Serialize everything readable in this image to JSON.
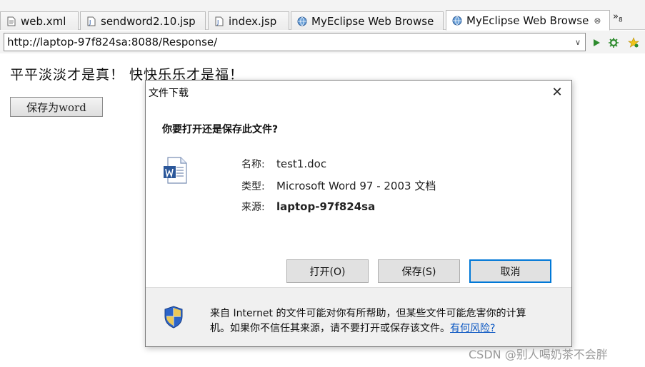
{
  "tabs": [
    {
      "label": "web.xml",
      "icon": "xml-file-icon",
      "active": false
    },
    {
      "label": "sendword2.10.jsp",
      "icon": "jsp-file-icon",
      "active": false
    },
    {
      "label": "index.jsp",
      "icon": "jsp-file-icon",
      "active": false
    },
    {
      "label": "MyEclipse Web Browse",
      "icon": "globe-icon",
      "active": false
    },
    {
      "label": "MyEclipse Web Browse",
      "icon": "globe-icon",
      "active": true,
      "close": "⊗"
    }
  ],
  "tab_overflow": {
    "label": "»",
    "count": "8"
  },
  "urlbar": {
    "url": "http://laptop-97f824sa:8088/Response/",
    "dropdown": "∨",
    "go_icon": "play-icon",
    "settings_icon": "gear-icon",
    "bookmark_icon": "star-icon",
    "accent": "#2e8b2e"
  },
  "page": {
    "text": "平平淡淡才是真！ 快快乐乐才是福！",
    "button_label": "保存为word"
  },
  "dialog": {
    "title": "文件下载",
    "close": "✕",
    "question": "你要打开还是保存此文件?",
    "name_label": "名称:",
    "name_value": "test1.doc",
    "type_label": "类型:",
    "type_value": "Microsoft Word 97 - 2003 文档",
    "source_label": "来源:",
    "source_value": "laptop-97f824sa",
    "open_button": "打开(O)",
    "save_button": "保存(S)",
    "cancel_button": "取消",
    "note_line1": "来自 Internet 的文件可能对你有所帮助，但某些文件可能危害你的计算",
    "note_line2": "机。如果你不信任其来源，请不要打开或保存该文件。",
    "risk_link": "有何风险?",
    "word_color": "#2b579a",
    "shield_color": "#2c64c8"
  },
  "watermark": "CSDN @别人喝奶茶不会胖"
}
